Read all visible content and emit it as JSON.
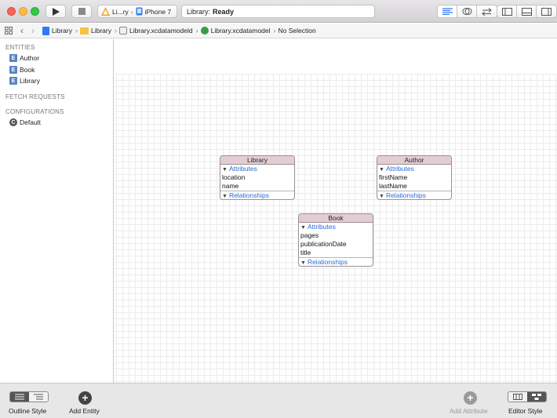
{
  "toolbar": {
    "scheme_app": "Li...ry",
    "scheme_device": "iPhone 7",
    "status_prefix": "Library:",
    "status_value": "Ready"
  },
  "jumpbar": {
    "crumbs": [
      "Library",
      "Library",
      "Library.xcdatamodeld",
      "Library.xcdatamodel",
      "No Selection"
    ]
  },
  "sidebar": {
    "entities_header": "ENTITIES",
    "entities": [
      {
        "badge": "E",
        "label": "Author"
      },
      {
        "badge": "E",
        "label": "Book"
      },
      {
        "badge": "E",
        "label": "Library"
      }
    ],
    "fetch_header": "FETCH REQUESTS",
    "config_header": "CONFIGURATIONS",
    "configurations": [
      {
        "badge": "C",
        "label": "Default"
      }
    ]
  },
  "diagram": {
    "attributes_label": "Attributes",
    "relationships_label": "Relationships",
    "entities": [
      {
        "name": "Library",
        "attributes": [
          "location",
          "name"
        ]
      },
      {
        "name": "Author",
        "attributes": [
          "firstName",
          "lastName"
        ]
      },
      {
        "name": "Book",
        "attributes": [
          "pages",
          "publicationDate",
          "title"
        ]
      }
    ]
  },
  "bottom": {
    "outline_style": "Outline Style",
    "add_entity": "Add Entity",
    "add_attribute": "Add Attribute",
    "editor_style": "Editor Style"
  },
  "colors": {
    "entity_header": "#e3cdd3",
    "link_blue": "#2a6ad6",
    "entity_badge": "#5a84c4"
  }
}
